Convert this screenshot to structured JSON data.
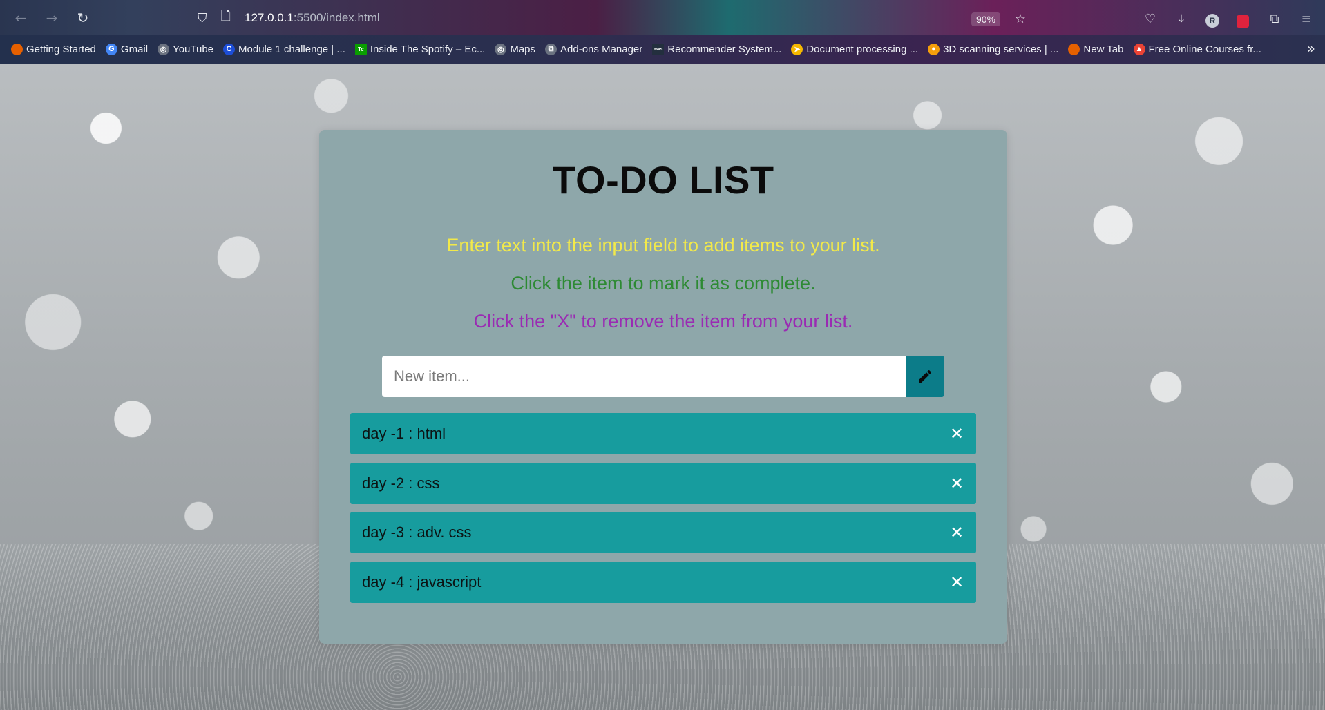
{
  "browser": {
    "url_host": "127.0.0.1",
    "url_path": ":5500/index.html",
    "zoom": "90%",
    "profile_initial": "R",
    "bookmarks": [
      {
        "label": "Getting Started",
        "icon": "firefox-icon",
        "color": "#e66000"
      },
      {
        "label": "Gmail",
        "icon": "google-icon",
        "color": "#4285f4"
      },
      {
        "label": "YouTube",
        "icon": "globe-icon",
        "color": "#6b7280"
      },
      {
        "label": "Module 1 challenge | ...",
        "icon": "c-icon",
        "color": "#1d4ed8"
      },
      {
        "label": "Inside The Spotify – Ec...",
        "icon": "techcrunch-icon",
        "color": "#0a9e01"
      },
      {
        "label": "Maps",
        "icon": "globe-icon",
        "color": "#6b7280"
      },
      {
        "label": "Add-ons Manager",
        "icon": "puzzle-icon",
        "color": "#6b7280"
      },
      {
        "label": "Recommender System...",
        "icon": "aws-icon",
        "color": "#232f3e"
      },
      {
        "label": "Document processing ...",
        "icon": "arrow-icon",
        "color": "#f5b800"
      },
      {
        "label": "3D scanning services | ...",
        "icon": "dot-icon",
        "color": "#f59e0b"
      },
      {
        "label": "New Tab",
        "icon": "firefox-icon",
        "color": "#e66000"
      },
      {
        "label": "Free Online Courses fr...",
        "icon": "colorful-icon",
        "color": "#ea4335"
      }
    ]
  },
  "app": {
    "title": "TO-DO LIST",
    "instructions": [
      "Enter text into the input field to add items to your list.",
      "Click the item to mark it as complete.",
      "Click the \"X\" to remove the item from your list."
    ],
    "input": {
      "placeholder": "New item...",
      "value": ""
    },
    "add_button_icon": "pencil-icon",
    "items": [
      {
        "text": "day -1 : html",
        "remove": "✕"
      },
      {
        "text": "day -2 : css",
        "remove": "✕"
      },
      {
        "text": "day -3 : adv. css",
        "remove": "✕"
      },
      {
        "text": "day -4 : javascript",
        "remove": "✕"
      }
    ],
    "colors": {
      "card": "#8ea7aa",
      "item": "#179c9e",
      "button": "#0c7c89",
      "instruction_1": "#f2e94a",
      "instruction_2": "#2d8a33",
      "instruction_3": "#9a2bb3"
    }
  }
}
